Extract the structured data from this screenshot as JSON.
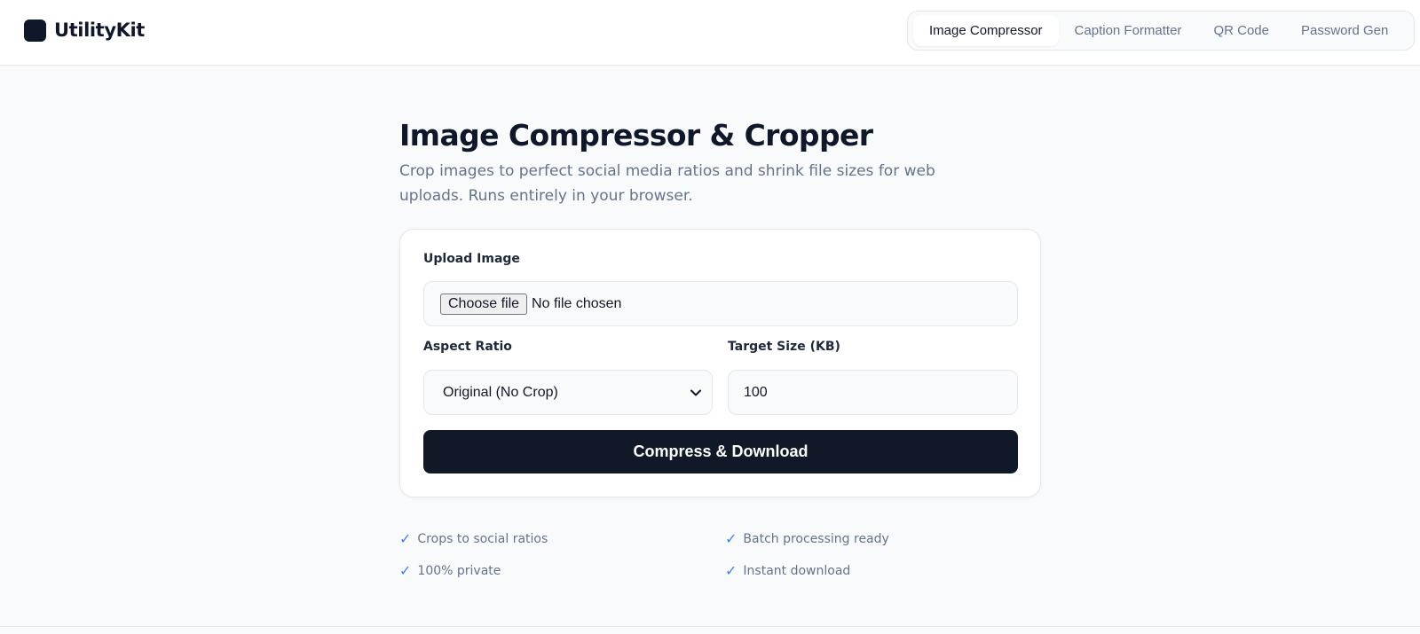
{
  "brand": {
    "name": "UtilityKit"
  },
  "nav": {
    "items": [
      {
        "label": "Image Compressor",
        "active": true
      },
      {
        "label": "Caption Formatter",
        "active": false
      },
      {
        "label": "QR Code",
        "active": false
      },
      {
        "label": "Password Gen",
        "active": false
      }
    ]
  },
  "page": {
    "title": "Image Compressor & Cropper",
    "subtitle": "Crop images to perfect social media ratios and shrink file sizes for web uploads. Runs entirely in your browser."
  },
  "form": {
    "upload_label": "Upload Image",
    "choose_file_label": "Choose file",
    "no_file_text": "No file chosen",
    "aspect_label": "Aspect Ratio",
    "aspect_value": "Original (No Crop)",
    "target_label": "Target Size (KB)",
    "target_value": "100",
    "submit_label": "Compress & Download"
  },
  "features": [
    "Crops to social ratios",
    "Batch processing ready",
    "100% private",
    "Instant download"
  ],
  "colors": {
    "primary": "#111827",
    "accent_check": "#3b82f6",
    "muted_text": "#64748b",
    "background": "#f8fafc"
  },
  "icons": {
    "check": "check-icon",
    "chevron": "chevron-down-icon",
    "logo": "brand-logo-icon"
  }
}
